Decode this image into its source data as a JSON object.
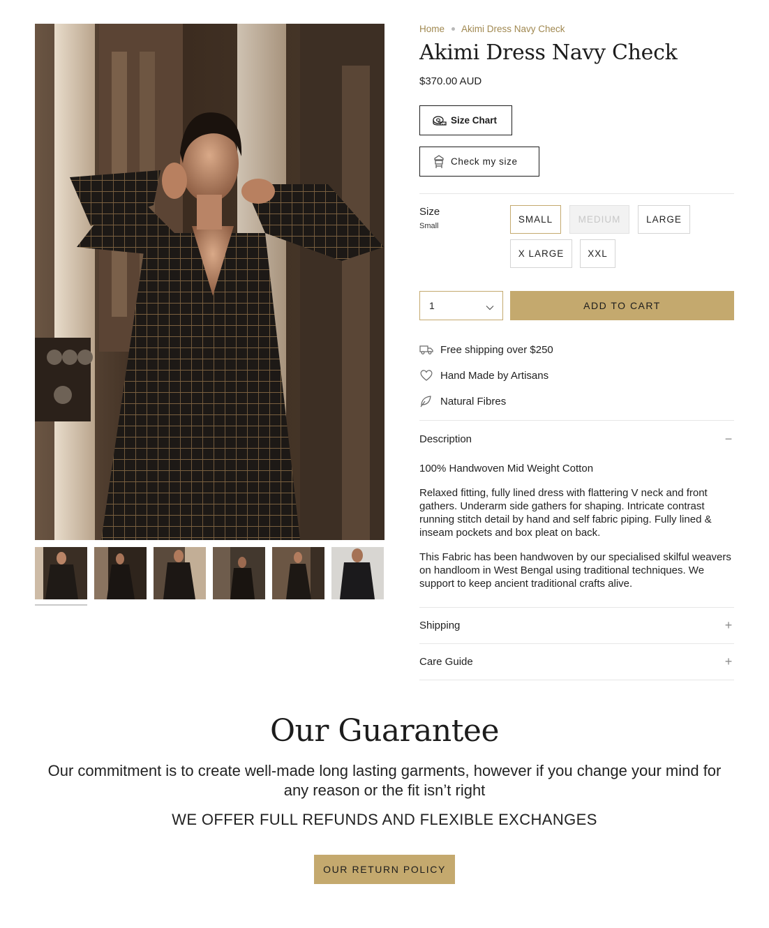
{
  "breadcrumb": {
    "home": "Home",
    "current": "Akimi Dress Navy Check"
  },
  "product": {
    "title": "Akimi Dress Navy Check",
    "price": "$370.00 AUD"
  },
  "buttons": {
    "size_chart": "Size Chart",
    "check_size": "Check my size",
    "add_to_cart": "ADD TO CART"
  },
  "size": {
    "label": "Size",
    "selected": "Small",
    "options": [
      "SMALL",
      "MEDIUM",
      "LARGE",
      "X LARGE",
      "XXL"
    ]
  },
  "quantity": {
    "value": "1"
  },
  "features": [
    {
      "icon": "truck-icon",
      "text": "Free shipping over $250"
    },
    {
      "icon": "heart-icon",
      "text": "Hand Made by Artisans"
    },
    {
      "icon": "leaf-icon",
      "text": "Natural Fibres"
    }
  ],
  "description": {
    "heading": "Description",
    "toggle": "−",
    "paragraphs": [
      "100% Handwoven Mid Weight Cotton",
      "Relaxed fitting, fully lined dress with flattering V neck and front gathers. Underarm side gathers for shaping.  Intricate contrast running stitch detail by hand and self fabric piping. Fully lined & inseam pockets and box pleat on back.",
      "This Fabric has been handwoven by our specialised skilful weavers on handloom in West Bengal using traditional techniques.  We support to keep ancient traditional crafts alive."
    ]
  },
  "accordions": {
    "shipping": {
      "heading": "Shipping",
      "toggle": "+"
    },
    "care": {
      "heading": "Care Guide",
      "toggle": "+"
    }
  },
  "guarantee": {
    "title": "Our Guarantee",
    "text": "Our commitment is to create well-made long lasting garments, however if you change your mind for any reason or the fit isn’t right",
    "offer": "WE OFFER FULL REFUNDS AND FLEXIBLE EXCHANGES",
    "button": "OUR RETURN POLICY"
  },
  "colors": {
    "accent": "#c4a96e",
    "breadcrumb": "#a08850",
    "text": "#222222"
  }
}
